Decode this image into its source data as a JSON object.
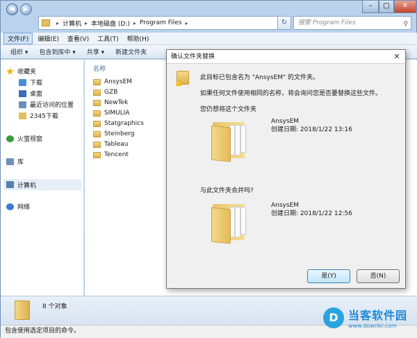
{
  "address": {
    "crumbs": [
      "计算机",
      "本地磁盘 (D:)",
      "Program Files"
    ]
  },
  "search": {
    "placeholder": "搜索 Program Files"
  },
  "menu": [
    "文件(F)",
    "编辑(E)",
    "查看(V)",
    "工具(T)",
    "帮助(H)"
  ],
  "toolbar": [
    "组织 ▾",
    "包含到库中 ▾",
    "共享 ▾",
    "新建文件夹"
  ],
  "sidebar": {
    "items": [
      {
        "label": "收藏夹",
        "icon": "star-icon",
        "color": "#f0b400"
      },
      {
        "label": "下载",
        "icon": "download-folder-icon",
        "color": "#4a8fd4"
      },
      {
        "label": "桌面",
        "icon": "desktop-icon",
        "color": "#3b6fb5"
      },
      {
        "label": "最近访问的位置",
        "icon": "recent-places-icon",
        "color": "#6a8fbf"
      },
      {
        "label": "2345下载",
        "icon": "folder-icon",
        "color": "#e3bf5e"
      },
      {
        "label": "火萤视窗",
        "icon": "app-icon",
        "color": "#3a9a3a"
      },
      {
        "label": "库",
        "icon": "library-icon",
        "color": "#6f8fb5"
      },
      {
        "label": "计算机",
        "icon": "computer-icon",
        "color": "#5580b0"
      },
      {
        "label": "网络",
        "icon": "network-icon",
        "color": "#3b7ccc"
      }
    ]
  },
  "content": {
    "column_header": "名称",
    "files": [
      "AnsysEM",
      "GZB",
      "NewTek",
      "SIMULIA",
      "Statgraphics",
      "Steinberg",
      "Tableau",
      "Tencent"
    ]
  },
  "details": {
    "count": "8 个对象"
  },
  "status": "包含使用选定项目的命令。",
  "dialog": {
    "title": "确认文件夹替换",
    "close": "✕",
    "line1": "此目标已包含名为 \"AnsysEM\" 的文件夹。",
    "line2": "如果任何文件使用相同的名称，将会询问您是否要替换这些文件。",
    "q1": "您仍想将这个文件夹",
    "target": {
      "name": "AnsysEM",
      "date": "创建日期: 2018/1/22 13:16"
    },
    "q2": "与此文件夹合并吗?",
    "source": {
      "name": "AnsysEM",
      "date": "创建日期: 2018/1/22 12:56"
    },
    "yes": "是(Y)",
    "no": "否(N)"
  },
  "logo": {
    "mark": "D",
    "title": "当客软件园",
    "url": "www.downkr.com"
  }
}
